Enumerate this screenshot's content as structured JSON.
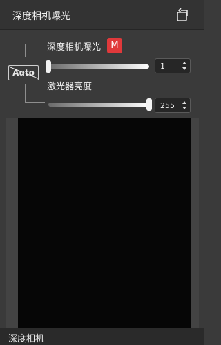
{
  "header": {
    "title": "深度相机曝光",
    "reset_icon": "rotate-reset-icon"
  },
  "auto": {
    "label": "Auto",
    "state": "disabled"
  },
  "exposure": {
    "label": "深度相机曝光",
    "mode_badge": "M",
    "value": "1",
    "slider_fraction": 0.0
  },
  "laser": {
    "label": "激光器亮度",
    "value": "255",
    "slider_fraction": 1.0
  },
  "footer": {
    "label": "深度相机"
  },
  "colors": {
    "badge": "#e0393b",
    "panel": "#3a3a3a",
    "video": "#060606"
  }
}
